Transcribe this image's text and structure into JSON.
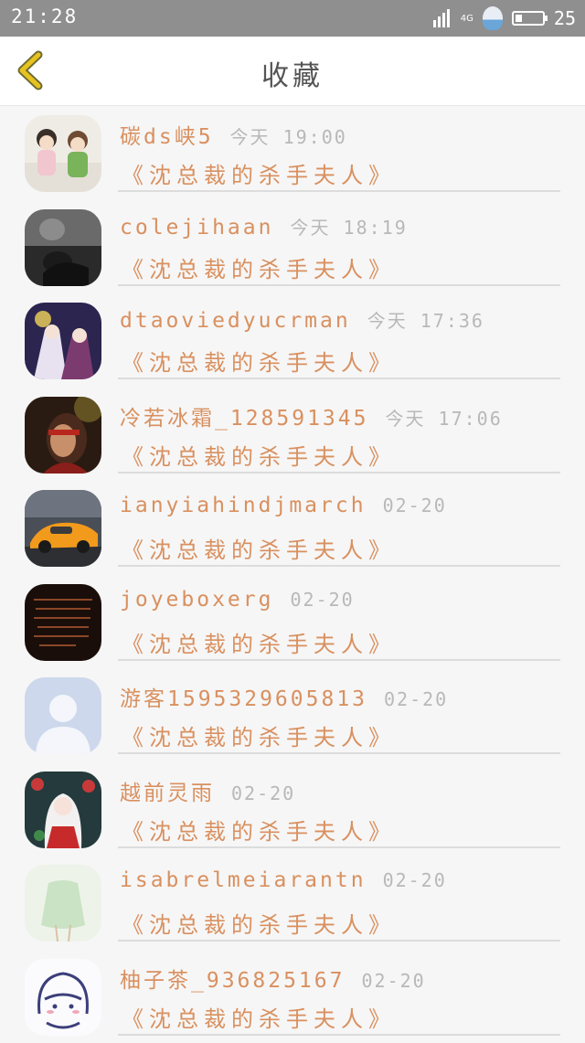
{
  "status_bar": {
    "time": "21:28",
    "network": "4G",
    "battery_level": 25,
    "battery_text": "25"
  },
  "nav": {
    "title": "收藏"
  },
  "favorites": [
    {
      "name": "碳ds峡5",
      "time": "今天 19:00",
      "book": "《沈总裁的杀手夫人》"
    },
    {
      "name": "colejihaan",
      "time": "今天 18:19",
      "book": "《沈总裁的杀手夫人》"
    },
    {
      "name": "dtaoviedyucrman",
      "time": "今天 17:36",
      "book": "《沈总裁的杀手夫人》"
    },
    {
      "name": "冷若冰霜_128591345",
      "time": "今天 17:06",
      "book": "《沈总裁的杀手夫人》"
    },
    {
      "name": "ianyiahindjmarch",
      "time": "02-20",
      "book": "《沈总裁的杀手夫人》"
    },
    {
      "name": "joyeboxerg",
      "time": "02-20",
      "book": "《沈总裁的杀手夫人》"
    },
    {
      "name": "游客1595329605813",
      "time": "02-20",
      "book": "《沈总裁的杀手夫人》"
    },
    {
      "name": "越前灵雨",
      "time": "02-20",
      "book": "《沈总裁的杀手夫人》"
    },
    {
      "name": "isabrelmeiarantn",
      "time": "02-20",
      "book": "《沈总裁的杀手夫人》"
    },
    {
      "name": "柚子茶_936825167",
      "time": "02-20",
      "book": "《沈总裁的杀手夫人》"
    }
  ],
  "colors": {
    "accent": "#d9905f",
    "back_arrow": "#e8c21e",
    "time_text": "#b8b8b8",
    "status_bar": "#8f8f8f"
  }
}
